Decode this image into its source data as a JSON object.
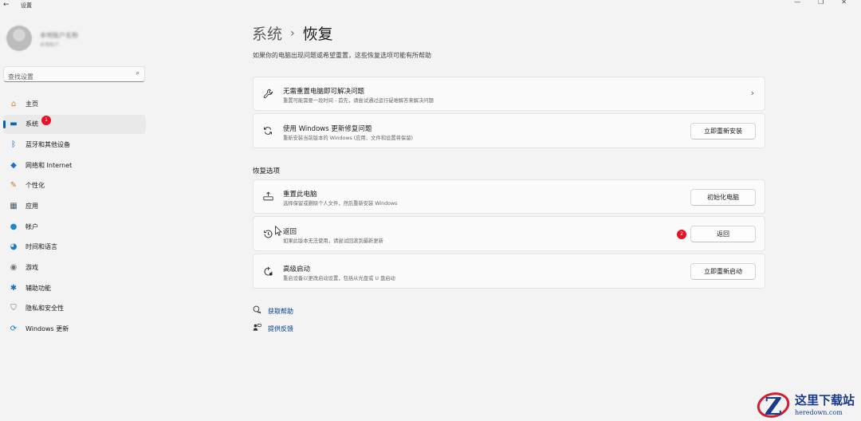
{
  "window": {
    "back_glyph": "←",
    "title": "设置",
    "controls": [
      "—",
      "❐",
      "✕"
    ]
  },
  "profile": {
    "name": "本地账户名称",
    "sub": "本地帐户"
  },
  "search": {
    "placeholder": "查找设置",
    "icon": "search-icon"
  },
  "sidebar": {
    "items": [
      {
        "label": "主页",
        "icon": "home-icon",
        "glyph": "⌂",
        "color": "#e8762d",
        "active": false
      },
      {
        "label": "系统",
        "icon": "monitor-icon",
        "glyph": "▬",
        "color": "#0067c0",
        "active": true,
        "badge": "1"
      },
      {
        "label": "蓝牙和其他设备",
        "icon": "bluetooth-icon",
        "glyph": "ᛒ",
        "color": "#0067c0",
        "active": false
      },
      {
        "label": "网络和 Internet",
        "icon": "wifi-icon",
        "glyph": "◆",
        "color": "#1f6fd1",
        "active": false
      },
      {
        "label": "个性化",
        "icon": "brush-icon",
        "glyph": "✎",
        "color": "#c87b2a",
        "active": false
      },
      {
        "label": "应用",
        "icon": "apps-icon",
        "glyph": "▦",
        "color": "#4a5a6a",
        "active": false
      },
      {
        "label": "帐户",
        "icon": "account-icon",
        "glyph": "●",
        "color": "#1e88c9",
        "active": false
      },
      {
        "label": "时间和语言",
        "icon": "clock-globe-icon",
        "glyph": "◕",
        "color": "#1e78c9",
        "active": false
      },
      {
        "label": "游戏",
        "icon": "gamepad-icon",
        "glyph": "◉",
        "color": "#6b7480",
        "active": false
      },
      {
        "label": "辅助功能",
        "icon": "accessibility-icon",
        "glyph": "✱",
        "color": "#1a6dc4",
        "active": false
      },
      {
        "label": "隐私和安全性",
        "icon": "shield-icon",
        "glyph": "⛉",
        "color": "#6b7480",
        "active": false
      },
      {
        "label": "Windows 更新",
        "icon": "windows-update-icon",
        "glyph": "⟳",
        "color": "#0a76d1",
        "active": false
      }
    ]
  },
  "breadcrumb": {
    "parent": "系统",
    "separator": "›",
    "current": "恢复"
  },
  "subtitle": "如果你的电脑出现问题或希望重置，这些恢复选项可能有所帮助",
  "top_cards": [
    {
      "icon": "wrench-icon",
      "glyph": "🔧",
      "title": "无需重置电脑即可解决问题",
      "desc": "重置可能需要一段时间 - 首先，请尝试通过运行疑难解答来解决问题",
      "chevron": "›"
    },
    {
      "icon": "refresh-icon",
      "glyph": "⟳",
      "title": "使用 Windows 更新修复问题",
      "desc": "重新安装当前版本的 Windows (应用、文件和设置将保留)",
      "button": "立即重新安装"
    }
  ],
  "recovery_section": {
    "label": "恢复选项",
    "cards": [
      {
        "icon": "reset-pc-icon",
        "glyph": "⏏",
        "title": "重置此电脑",
        "desc": "选择保留或删除个人文件，然后重新安装 Windows",
        "button": "初始化电脑"
      },
      {
        "icon": "history-icon",
        "glyph": "⟲",
        "title": "返回",
        "desc": "如果此版本无法使用，请尝试回滚到最新更新",
        "button": "返回",
        "step_badge": "2"
      },
      {
        "icon": "advanced-startup-icon",
        "glyph": "⚙",
        "title": "高级启动",
        "desc": "重启设备以更改启动设置，包括从光盘或 U 盘启动",
        "button": "立即重新启动"
      }
    ]
  },
  "help_links": [
    {
      "label": "获取帮助",
      "icon": "help-chat-icon",
      "glyph": "💬"
    },
    {
      "label": "提供反馈",
      "icon": "feedback-icon",
      "glyph": "✉"
    }
  ],
  "watermark": {
    "cn": "这里下载站",
    "en": "heredown.com"
  },
  "colors": {
    "accent": "#005fb8",
    "badge": "#e81123",
    "link": "#003e92"
  }
}
